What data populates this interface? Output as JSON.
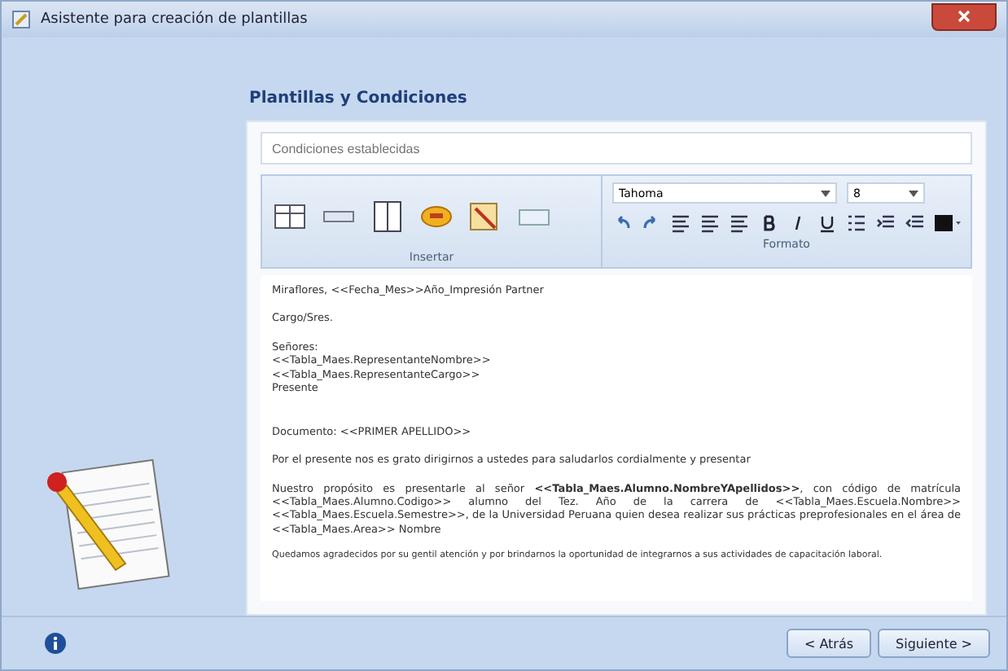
{
  "window": {
    "title": "Asistente para creación de plantillas"
  },
  "heading": "Plantillas y Condiciones",
  "search": {
    "placeholder": "Condiciones establecidas"
  },
  "ribbon": {
    "groups": [
      "Insertar",
      "Formato"
    ],
    "font": "Tahoma",
    "size": "8"
  },
  "document": {
    "lines": [
      {
        "kind": "line",
        "text": "Miraflores, <<Fecha_Mes>>Año_Impresión Partner"
      },
      {
        "kind": "line",
        "text": "Cargo/Sres."
      },
      {
        "kind": "block",
        "lines": [
          "Señores:",
          "<<Tabla_Maes.RepresentanteNombre>>",
          "<<Tabla_Maes.RepresentanteCargo>>",
          "Presente"
        ]
      },
      {
        "kind": "line",
        "text": "Documento: <<PRIMER APELLIDO>>"
      },
      {
        "kind": "line",
        "text": "Por el presente nos es grato dirigirnos a ustedes para saludarlos cordialmente y presentar"
      },
      {
        "kind": "para",
        "text": "Nuestro propósito es presentarle al señor **<<Tabla_Maes.Alumno.NombreYApellidos>>**, con código de matrícula <<Tabla_Maes.Alumno.Codigo>> alumno del Tez. Año de la carrera de <<Tabla_Maes.Escuela.Nombre>> <<Tabla_Maes.Escuela.Semestre>>, de la Universidad Peruana quien desea realizar sus prácticas preprofesionales en el área de <<Tabla_Maes.Area>> Nombre"
      },
      {
        "kind": "small",
        "text": "Quedamos agradecidos por su gentil atención y por brindarnos la oportunidad de integrarnos a sus actividades de capacitación laboral."
      }
    ]
  },
  "footer": {
    "buttons": [
      "< Atrás",
      "Siguiente >"
    ]
  }
}
